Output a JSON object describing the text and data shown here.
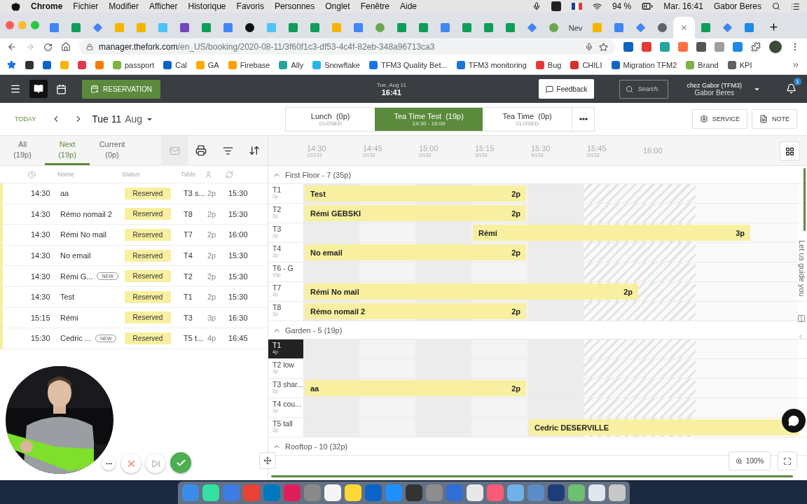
{
  "menu_bar": {
    "app": "Chrome",
    "items": [
      "Fichier",
      "Modifier",
      "Afficher",
      "Historique",
      "Favoris",
      "Personnes",
      "Onglet",
      "Fenêtre",
      "Aide"
    ],
    "battery": "94 %",
    "clock": "Mar. 16:41",
    "user": "Gabor Beres"
  },
  "browser": {
    "tabs": [
      {
        "kind": "docs",
        "selected": false
      },
      {
        "kind": "sheets",
        "selected": false
      },
      {
        "kind": "diamond",
        "selected": false
      },
      {
        "kind": "slides",
        "selected": false
      },
      {
        "kind": "slides",
        "selected": false
      },
      {
        "kind": "snowflake",
        "selected": false
      },
      {
        "kind": "forms",
        "selected": false
      },
      {
        "kind": "sheets",
        "selected": false
      },
      {
        "kind": "docs",
        "selected": false
      },
      {
        "kind": "circle",
        "selected": false
      },
      {
        "kind": "snowflake",
        "selected": false
      },
      {
        "kind": "sheets",
        "selected": false
      },
      {
        "kind": "sheets",
        "selected": false
      },
      {
        "kind": "slides",
        "selected": false
      },
      {
        "kind": "docs",
        "selected": false
      },
      {
        "kind": "leaf",
        "selected": false
      },
      {
        "kind": "sheets",
        "selected": false
      },
      {
        "kind": "sheets",
        "selected": false
      },
      {
        "kind": "docs",
        "selected": false
      },
      {
        "kind": "sheets",
        "selected": false
      },
      {
        "kind": "sheets",
        "selected": false
      },
      {
        "kind": "sheets",
        "selected": false
      },
      {
        "kind": "diamond",
        "selected": false
      },
      {
        "kind": "leaf",
        "selected": false
      },
      {
        "kind": "text",
        "label": "Nev",
        "selected": false
      },
      {
        "kind": "slides",
        "selected": false
      },
      {
        "kind": "docs",
        "selected": false
      },
      {
        "kind": "diamond",
        "selected": false
      },
      {
        "kind": "globe",
        "selected": false
      },
      {
        "kind": "blank",
        "selected": true
      },
      {
        "kind": "sheets",
        "selected": false
      },
      {
        "kind": "diamond",
        "selected": false
      },
      {
        "kind": "video",
        "selected": false
      }
    ],
    "url": {
      "host": "manager.thefork.com",
      "path": "/en_US/booking/2020-08-11/3f60f1c3-df53-4c4f-82eb-348a96713ca3"
    },
    "extensions": [
      {
        "color": "#0a66c2"
      },
      {
        "color": "#e53935"
      },
      {
        "color": "#26a69a"
      },
      {
        "color": "#ff7043"
      },
      {
        "color": "#555555"
      },
      {
        "color": "#9e9e9e"
      },
      {
        "color": "#1e88e5"
      }
    ],
    "bookmarks": [
      {
        "color": "#333333"
      },
      {
        "color": "#0a66c2"
      },
      {
        "color": "#f4b400"
      },
      {
        "color": "#e0384f"
      },
      {
        "color": "#f57c00"
      },
      {
        "label": "passport",
        "color": "#7cb342"
      },
      {
        "label": "Cal",
        "color": "#0a64c8"
      },
      {
        "label": "GA",
        "color": "#f9ab00"
      },
      {
        "label": "Firebase",
        "color": "#ffa000"
      },
      {
        "label": "Ally",
        "color": "#26a69a"
      },
      {
        "label": "Snowflake",
        "color": "#29b5e8"
      },
      {
        "label": "TFM3 Quality Bet...",
        "color": "#1a73e8"
      },
      {
        "label": "TFM3 monitoring",
        "color": "#1976d2"
      },
      {
        "label": "Bug",
        "color": "#e53935"
      },
      {
        "label": "CHILI",
        "color": "#d32f2f"
      },
      {
        "label": "Migration TFM2",
        "color": "#1565c0"
      },
      {
        "label": "Brand",
        "color": "#7cb342"
      },
      {
        "label": "KPI",
        "color": "#616161"
      }
    ]
  },
  "header": {
    "reservation": "RESERVATION",
    "date": "Tue, Aug 11",
    "time": "16:41",
    "feedback": "Feedback",
    "search_placeholder": "Search.",
    "venue": "chez Gabor (TFM3)",
    "user": "Gabor Beres",
    "notifications": "1"
  },
  "date_bar": {
    "today": "TODAY",
    "day": "Tue 11",
    "month": "Aug",
    "services": [
      {
        "name": "Lunch  (0p)",
        "sub": "CLOSED",
        "selected": false
      },
      {
        "name": "Tea Time Test  (19p)",
        "sub": "14:30 - 16:00",
        "selected": true
      },
      {
        "name": "Tea Time  (0p)",
        "sub": "CLOSED",
        "selected": false
      }
    ],
    "service": "SERVICE",
    "note": "NOTE"
  },
  "list": {
    "tabs": [
      {
        "label": "All",
        "count": "(19p)",
        "selected": false
      },
      {
        "label": "Next",
        "count": "(19p)",
        "selected": true
      },
      {
        "label": "Current",
        "count": "(0p)",
        "selected": false
      }
    ],
    "columns": {
      "name": "Name",
      "status": "Status",
      "table": "Table"
    },
    "rows": [
      {
        "time": "14:30",
        "name": "aa",
        "new": false,
        "status": "Reserved",
        "table": "T3 s...",
        "covers": "2p",
        "end": "15:30"
      },
      {
        "time": "14:30",
        "name": "Rémo nomail 2",
        "new": false,
        "status": "Reserved",
        "table": "T8",
        "covers": "2p",
        "end": "15:30"
      },
      {
        "time": "14:30",
        "name": "Rémi No mail",
        "new": false,
        "status": "Reserved",
        "table": "T7",
        "covers": "2p",
        "end": "16:00"
      },
      {
        "time": "14:30",
        "name": "No email",
        "new": false,
        "status": "Reserved",
        "table": "T4",
        "covers": "2p",
        "end": "15:30"
      },
      {
        "time": "14:30",
        "name": "Rémi G...",
        "new": true,
        "badge": "NEW",
        "status": "Reserved",
        "table": "T2",
        "covers": "2p",
        "end": "15:30"
      },
      {
        "time": "14:30",
        "name": "Test",
        "new": false,
        "status": "Reserved",
        "table": "T1",
        "covers": "2p",
        "end": "15:30"
      },
      {
        "time": "15:15",
        "name": "Rémi",
        "new": false,
        "status": "Reserved",
        "table": "T3",
        "covers": "3p",
        "end": "16:30"
      },
      {
        "time": "15:30",
        "name": "Cedric ...",
        "new": true,
        "badge": "NEW",
        "status": "Reserved",
        "table": "T5 t...",
        "covers": "4p",
        "end": "16:45"
      }
    ]
  },
  "timeline": {
    "slots": [
      {
        "time": "14:30",
        "count": "12/133"
      },
      {
        "time": "14:45",
        "count": "0/133"
      },
      {
        "time": "15:00",
        "count": "0/133"
      },
      {
        "time": "15:15",
        "count": "3/133"
      },
      {
        "time": "15:30",
        "count": "4/133"
      },
      {
        "time": "15:45",
        "count": "0/133"
      },
      {
        "time": "16:00"
      }
    ],
    "sections": [
      {
        "title": "First Floor - 7 (35p)",
        "expanded": true,
        "tables": [
          {
            "name": "T1",
            "capacity": "2p",
            "selected": false,
            "booking": {
              "name": "Test",
              "covers": "2p"
            }
          },
          {
            "name": "T2",
            "capacity": "2p",
            "selected": false,
            "booking": {
              "name": "Rémi GEBSKI",
              "covers": "2p"
            }
          },
          {
            "name": "T3",
            "capacity": "2p",
            "selected": false,
            "booking": {
              "name": "Rémi",
              "covers": "3p"
            }
          },
          {
            "name": "T4",
            "capacity": "2p",
            "selected": false,
            "booking": {
              "name": "No email",
              "covers": "2p"
            }
          },
          {
            "name": "T6 - G",
            "capacity": "10p",
            "selected": false
          },
          {
            "name": "T7",
            "capacity": "2p",
            "selected": false,
            "booking": {
              "name": "Rémi No mail",
              "covers": "2p"
            }
          },
          {
            "name": "T8",
            "capacity": "2p",
            "selected": false,
            "booking": {
              "name": "Rémo nomail 2",
              "covers": "2p"
            }
          }
        ]
      },
      {
        "title": "Garden - 5 (19p)",
        "expanded": true,
        "tables": [
          {
            "name": "T1",
            "capacity": "4p",
            "selected": true
          },
          {
            "name": "T2 low",
            "capacity": "3p",
            "selected": false
          },
          {
            "name": "T3 shar...",
            "capacity": "2p",
            "selected": false,
            "booking": {
              "name": "aa",
              "covers": "2p"
            }
          },
          {
            "name": "T4 cou...",
            "capacity": "2p",
            "selected": false
          },
          {
            "name": "T5 tall",
            "capacity": "2p",
            "selected": false,
            "booking": {
              "name": "Cedric DESERVILLE"
            }
          }
        ]
      },
      {
        "title": "Rooftop - 10 (32p)",
        "expanded": true
      }
    ],
    "guide": "Let us guide you",
    "zoom": "100%"
  },
  "dock": [
    {
      "color": "#3b8ee8"
    },
    {
      "color": "#34e0a1"
    },
    {
      "color": "#3d7be5"
    },
    {
      "color": "#e94235"
    },
    {
      "color": "#0079bf"
    },
    {
      "color": "#e01e5a"
    },
    {
      "color": "#8a8a8a"
    },
    {
      "color": "#f5f5f5"
    },
    {
      "color": "#fdd835"
    },
    {
      "color": "#0a64c8"
    },
    {
      "color": "#1e90ff"
    },
    {
      "color": "#333333"
    },
    {
      "color": "#8d8d8d"
    },
    {
      "color": "#2f6fd6"
    },
    {
      "color": "#e8e8e8"
    },
    {
      "color": "#fa5b76"
    },
    {
      "color": "#6fb1e8"
    },
    {
      "color": "#5b8cc8"
    },
    {
      "color": "#1c3d7a"
    },
    {
      "color": "#6cc070"
    },
    {
      "color": "#dfe6ee"
    },
    {
      "color": "#c8c8c8"
    }
  ]
}
